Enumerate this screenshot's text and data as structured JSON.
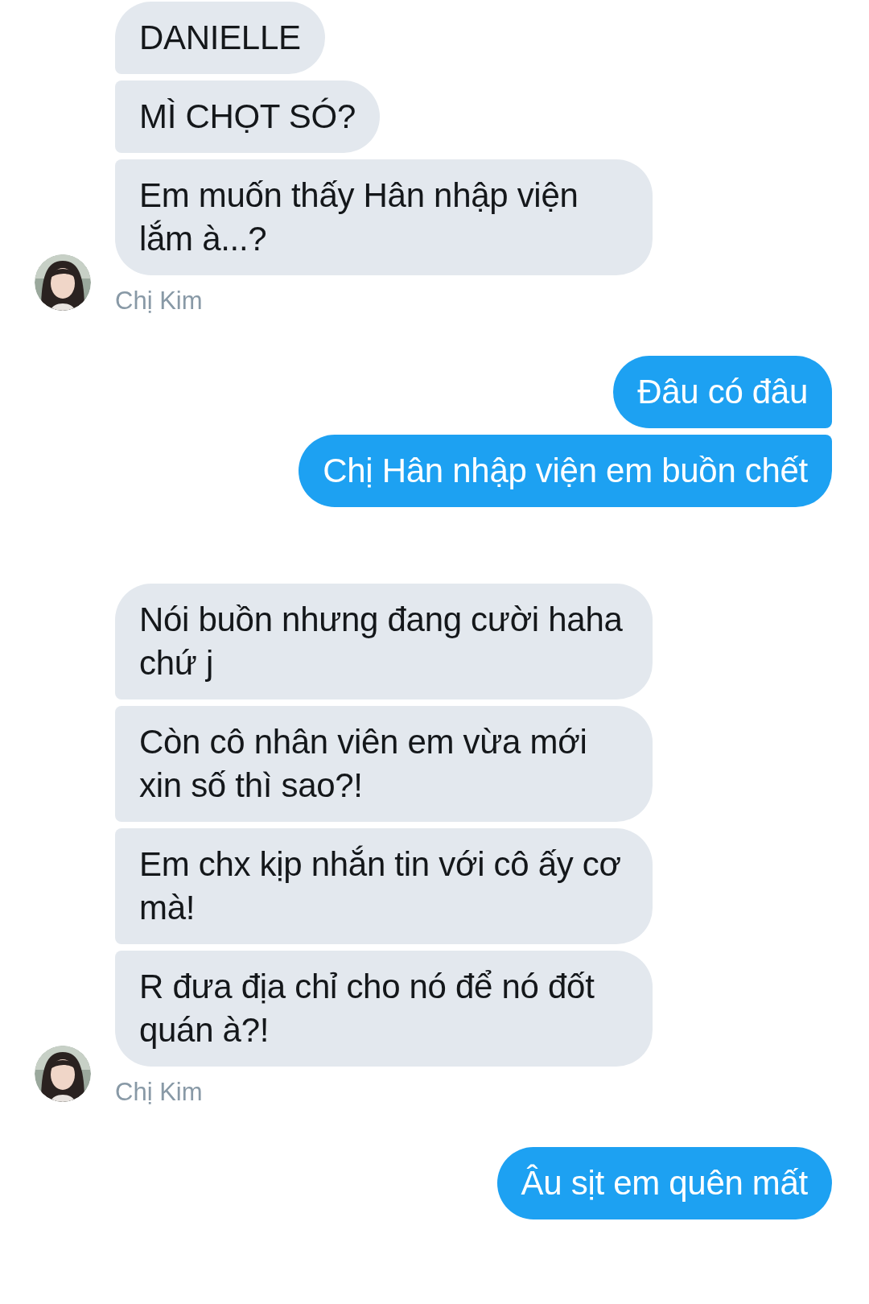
{
  "messages": [
    {
      "kind": "received",
      "sender": "Chị Kim",
      "bubbles": [
        "DANIELLE",
        "MÌ CHỌT SÓ?",
        "Em muốn thấy Hân nhập viện lắm à...?"
      ]
    },
    {
      "kind": "sent",
      "bubbles": [
        "Đâu có đâu",
        "Chị Hân nhập viện em buồn chết"
      ]
    },
    {
      "kind": "received",
      "sender": "Chị Kim",
      "bubbles": [
        "Nói buồn nhưng đang cười haha chứ j",
        "Còn cô nhân viên em vừa mới xin số thì sao?!",
        "Em chx kịp nhắn tin với cô ấy cơ mà!",
        "R đưa địa chỉ cho nó để nó đốt quán à?!"
      ]
    },
    {
      "kind": "sent",
      "bubbles": [
        "Âu sịt em quên mất"
      ]
    }
  ]
}
